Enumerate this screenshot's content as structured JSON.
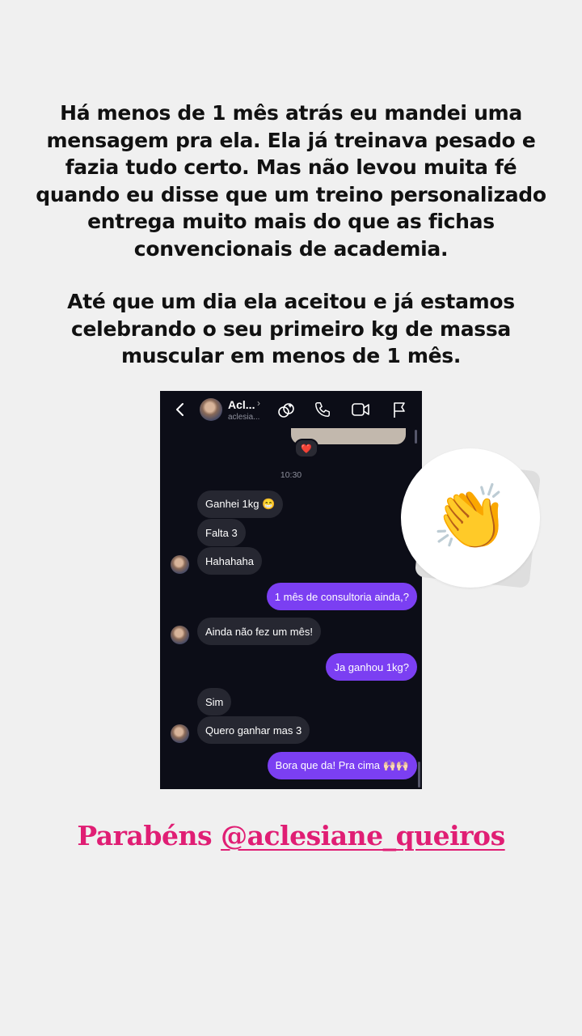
{
  "story": {
    "paragraph1": "Há menos de 1 mês atrás eu mandei uma mensagem pra ela. Ela já treinava pesado e fazia tudo certo. Mas não levou muita fé quando eu disse que um treino personalizado entrega muito mais do que as fichas convencionais de academia.",
    "paragraph2": "Até que um dia ela aceitou e já estamos celebrando o seu primeiro kg de massa muscular em menos de 1 mês.",
    "congrats_prefix": "Parabéns",
    "mention": "@aclesiane_queiros",
    "text_color": "#111111",
    "accent_color": "#e01e74",
    "sticker_emoji": "👏"
  },
  "chat": {
    "header": {
      "name": "Acl...",
      "username": "aclesia...",
      "icons": [
        "back-chevron-icon",
        "avatar",
        "effects-icon",
        "phone-icon",
        "video-icon",
        "flag-icon"
      ]
    },
    "previous_reaction": "❤️",
    "timestamp": "10:30",
    "messages": [
      {
        "side": "in",
        "text": "Ganhei 1kg 😁"
      },
      {
        "side": "in",
        "text": "Falta 3"
      },
      {
        "side": "in",
        "text": "Hahahaha"
      },
      {
        "side": "out",
        "text": "1 mês de consultoria ainda,?"
      },
      {
        "side": "in",
        "text": "Ainda não fez um mês!"
      },
      {
        "side": "out",
        "text": "Ja ganhou 1kg?"
      },
      {
        "side": "in",
        "text": "Sim"
      },
      {
        "side": "in",
        "text": "Quero ganhar mas 3"
      },
      {
        "side": "out",
        "text": "Bora que da! Pra cima 🙌🏻🙌🏻"
      }
    ],
    "colors": {
      "background": "#0c0d17",
      "incoming": "#262731",
      "outgoing": "#7b3ff2"
    }
  }
}
